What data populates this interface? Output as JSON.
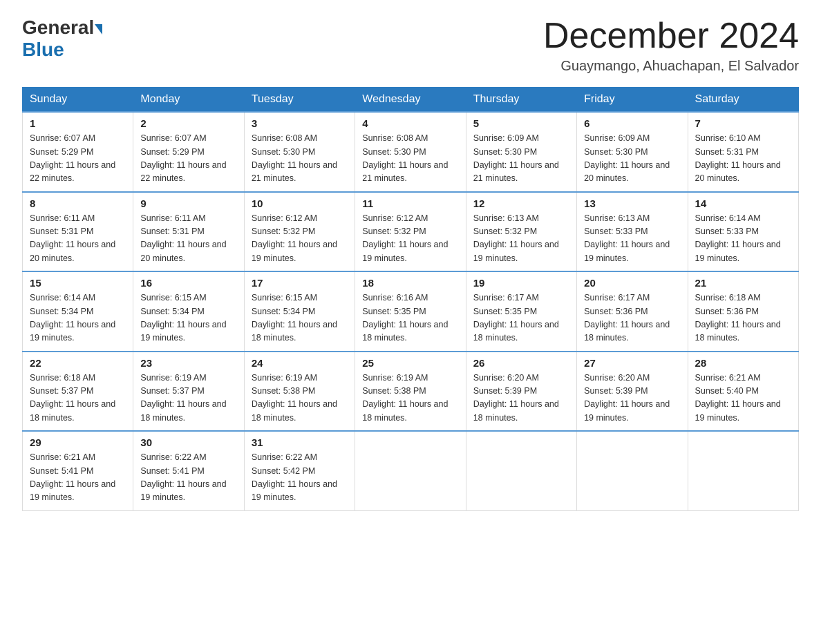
{
  "header": {
    "logo_general": "General",
    "logo_blue": "Blue",
    "month_title": "December 2024",
    "location": "Guaymango, Ahuachapan, El Salvador"
  },
  "days_of_week": [
    "Sunday",
    "Monday",
    "Tuesday",
    "Wednesday",
    "Thursday",
    "Friday",
    "Saturday"
  ],
  "weeks": [
    [
      {
        "day": "1",
        "sunrise": "6:07 AM",
        "sunset": "5:29 PM",
        "daylight": "11 hours and 22 minutes."
      },
      {
        "day": "2",
        "sunrise": "6:07 AM",
        "sunset": "5:29 PM",
        "daylight": "11 hours and 22 minutes."
      },
      {
        "day": "3",
        "sunrise": "6:08 AM",
        "sunset": "5:30 PM",
        "daylight": "11 hours and 21 minutes."
      },
      {
        "day": "4",
        "sunrise": "6:08 AM",
        "sunset": "5:30 PM",
        "daylight": "11 hours and 21 minutes."
      },
      {
        "day": "5",
        "sunrise": "6:09 AM",
        "sunset": "5:30 PM",
        "daylight": "11 hours and 21 minutes."
      },
      {
        "day": "6",
        "sunrise": "6:09 AM",
        "sunset": "5:30 PM",
        "daylight": "11 hours and 20 minutes."
      },
      {
        "day": "7",
        "sunrise": "6:10 AM",
        "sunset": "5:31 PM",
        "daylight": "11 hours and 20 minutes."
      }
    ],
    [
      {
        "day": "8",
        "sunrise": "6:11 AM",
        "sunset": "5:31 PM",
        "daylight": "11 hours and 20 minutes."
      },
      {
        "day": "9",
        "sunrise": "6:11 AM",
        "sunset": "5:31 PM",
        "daylight": "11 hours and 20 minutes."
      },
      {
        "day": "10",
        "sunrise": "6:12 AM",
        "sunset": "5:32 PM",
        "daylight": "11 hours and 19 minutes."
      },
      {
        "day": "11",
        "sunrise": "6:12 AM",
        "sunset": "5:32 PM",
        "daylight": "11 hours and 19 minutes."
      },
      {
        "day": "12",
        "sunrise": "6:13 AM",
        "sunset": "5:32 PM",
        "daylight": "11 hours and 19 minutes."
      },
      {
        "day": "13",
        "sunrise": "6:13 AM",
        "sunset": "5:33 PM",
        "daylight": "11 hours and 19 minutes."
      },
      {
        "day": "14",
        "sunrise": "6:14 AM",
        "sunset": "5:33 PM",
        "daylight": "11 hours and 19 minutes."
      }
    ],
    [
      {
        "day": "15",
        "sunrise": "6:14 AM",
        "sunset": "5:34 PM",
        "daylight": "11 hours and 19 minutes."
      },
      {
        "day": "16",
        "sunrise": "6:15 AM",
        "sunset": "5:34 PM",
        "daylight": "11 hours and 19 minutes."
      },
      {
        "day": "17",
        "sunrise": "6:15 AM",
        "sunset": "5:34 PM",
        "daylight": "11 hours and 18 minutes."
      },
      {
        "day": "18",
        "sunrise": "6:16 AM",
        "sunset": "5:35 PM",
        "daylight": "11 hours and 18 minutes."
      },
      {
        "day": "19",
        "sunrise": "6:17 AM",
        "sunset": "5:35 PM",
        "daylight": "11 hours and 18 minutes."
      },
      {
        "day": "20",
        "sunrise": "6:17 AM",
        "sunset": "5:36 PM",
        "daylight": "11 hours and 18 minutes."
      },
      {
        "day": "21",
        "sunrise": "6:18 AM",
        "sunset": "5:36 PM",
        "daylight": "11 hours and 18 minutes."
      }
    ],
    [
      {
        "day": "22",
        "sunrise": "6:18 AM",
        "sunset": "5:37 PM",
        "daylight": "11 hours and 18 minutes."
      },
      {
        "day": "23",
        "sunrise": "6:19 AM",
        "sunset": "5:37 PM",
        "daylight": "11 hours and 18 minutes."
      },
      {
        "day": "24",
        "sunrise": "6:19 AM",
        "sunset": "5:38 PM",
        "daylight": "11 hours and 18 minutes."
      },
      {
        "day": "25",
        "sunrise": "6:19 AM",
        "sunset": "5:38 PM",
        "daylight": "11 hours and 18 minutes."
      },
      {
        "day": "26",
        "sunrise": "6:20 AM",
        "sunset": "5:39 PM",
        "daylight": "11 hours and 18 minutes."
      },
      {
        "day": "27",
        "sunrise": "6:20 AM",
        "sunset": "5:39 PM",
        "daylight": "11 hours and 19 minutes."
      },
      {
        "day": "28",
        "sunrise": "6:21 AM",
        "sunset": "5:40 PM",
        "daylight": "11 hours and 19 minutes."
      }
    ],
    [
      {
        "day": "29",
        "sunrise": "6:21 AM",
        "sunset": "5:41 PM",
        "daylight": "11 hours and 19 minutes."
      },
      {
        "day": "30",
        "sunrise": "6:22 AM",
        "sunset": "5:41 PM",
        "daylight": "11 hours and 19 minutes."
      },
      {
        "day": "31",
        "sunrise": "6:22 AM",
        "sunset": "5:42 PM",
        "daylight": "11 hours and 19 minutes."
      },
      null,
      null,
      null,
      null
    ]
  ]
}
